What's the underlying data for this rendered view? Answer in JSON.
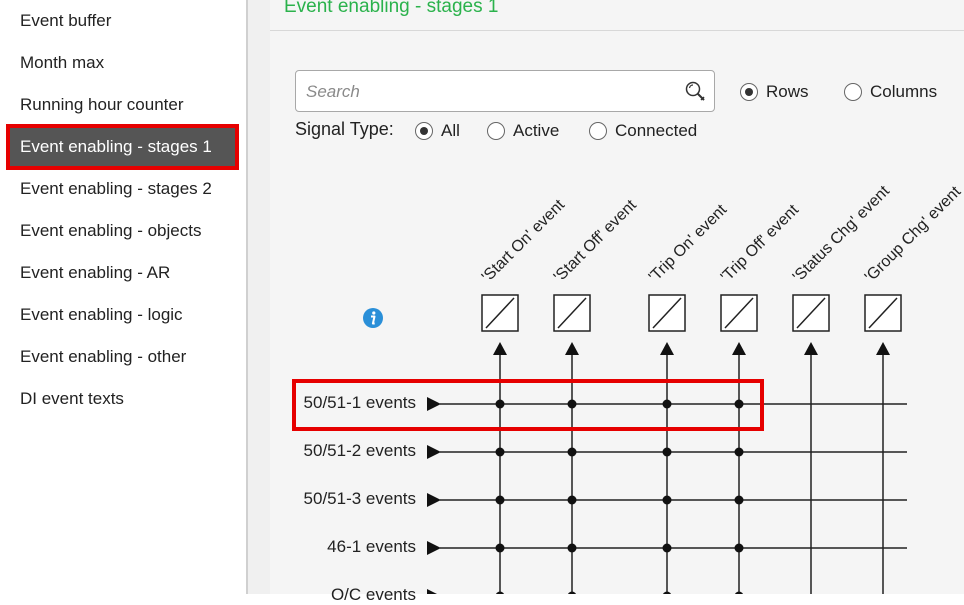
{
  "sidebar": {
    "items": [
      {
        "label": "Event buffer",
        "selected": false
      },
      {
        "label": "Month max",
        "selected": false
      },
      {
        "label": "Running hour counter",
        "selected": false
      },
      {
        "label": "Event enabling - stages 1",
        "selected": true
      },
      {
        "label": "Event enabling - stages 2",
        "selected": false
      },
      {
        "label": "Event enabling - objects",
        "selected": false
      },
      {
        "label": "Event enabling - AR",
        "selected": false
      },
      {
        "label": "Event enabling - logic",
        "selected": false
      },
      {
        "label": "Event enabling - other",
        "selected": false
      },
      {
        "label": "DI event texts",
        "selected": false
      }
    ]
  },
  "main": {
    "title": "Event enabling - stages 1",
    "search": {
      "placeholder": "Search",
      "value": ""
    },
    "view_mode": {
      "options": [
        {
          "label": "Rows",
          "checked": true
        },
        {
          "label": "Columns",
          "checked": false
        }
      ]
    },
    "signal_type": {
      "label": "Signal Type:",
      "options": [
        {
          "label": "All",
          "checked": true
        },
        {
          "label": "Active",
          "checked": false
        },
        {
          "label": "Connected",
          "checked": false
        }
      ]
    },
    "columns": [
      "'Start On' event",
      "'Start Off' event",
      "'Trip On' event",
      "'Trip Off' event",
      "'Status Chg' event",
      "'Group Chg' event"
    ],
    "rows": [
      {
        "label": "50/51-1 events",
        "connected": [
          true,
          true,
          true,
          true,
          false,
          false
        ]
      },
      {
        "label": "50/51-2 events",
        "connected": [
          true,
          true,
          true,
          true,
          false,
          false
        ]
      },
      {
        "label": "50/51-3 events",
        "connected": [
          true,
          true,
          true,
          true,
          false,
          false
        ]
      },
      {
        "label": "46-1 events",
        "connected": [
          true,
          true,
          true,
          true,
          false,
          false
        ]
      },
      {
        "label": "O/C events",
        "connected": [
          true,
          true,
          true,
          true,
          false,
          false
        ]
      }
    ]
  },
  "colors": {
    "accent_green": "#2bb24c",
    "highlight_red": "#e60000",
    "selected_bg": "#555555",
    "info_blue": "#2a8fd8"
  }
}
